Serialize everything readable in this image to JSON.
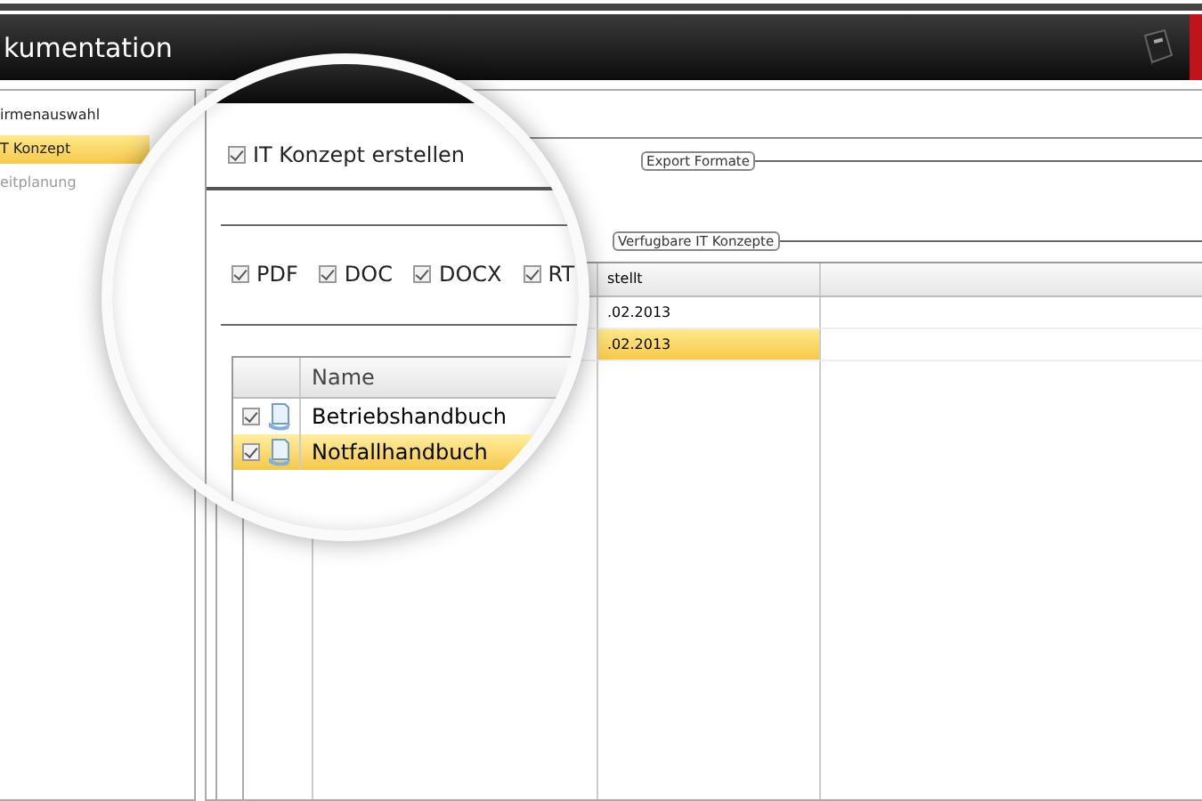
{
  "window": {
    "title": "kumentation"
  },
  "sidebar": {
    "items": [
      {
        "label": "irmenauswahl",
        "selected": false,
        "disabled": false
      },
      {
        "label": "T Konzept",
        "selected": true,
        "disabled": false
      },
      {
        "label": "eitplanung",
        "selected": false,
        "disabled": true
      }
    ]
  },
  "export_group": {
    "legend": "Export Formate"
  },
  "concepts_group": {
    "legend": "Verfugbare IT Konzepte",
    "columns": [
      "stellt"
    ],
    "rows": [
      {
        "date": ".02.2013",
        "selected": false
      },
      {
        "date": ".02.2013",
        "selected": true
      }
    ]
  },
  "magnifier": {
    "create_option": {
      "label": "IT Konzept erstellen",
      "checked": true
    },
    "formats": [
      {
        "label": "PDF",
        "checked": true
      },
      {
        "label": "DOC",
        "checked": true
      },
      {
        "label": "DOCX",
        "checked": true
      },
      {
        "label": "RT",
        "checked": true
      }
    ],
    "table": {
      "columns": [
        "Name"
      ],
      "rows": [
        {
          "name": "Betriebshandbuch",
          "checked": true,
          "selected": false
        },
        {
          "name": "Notfallhandbuch",
          "checked": true,
          "selected": true
        }
      ]
    }
  }
}
